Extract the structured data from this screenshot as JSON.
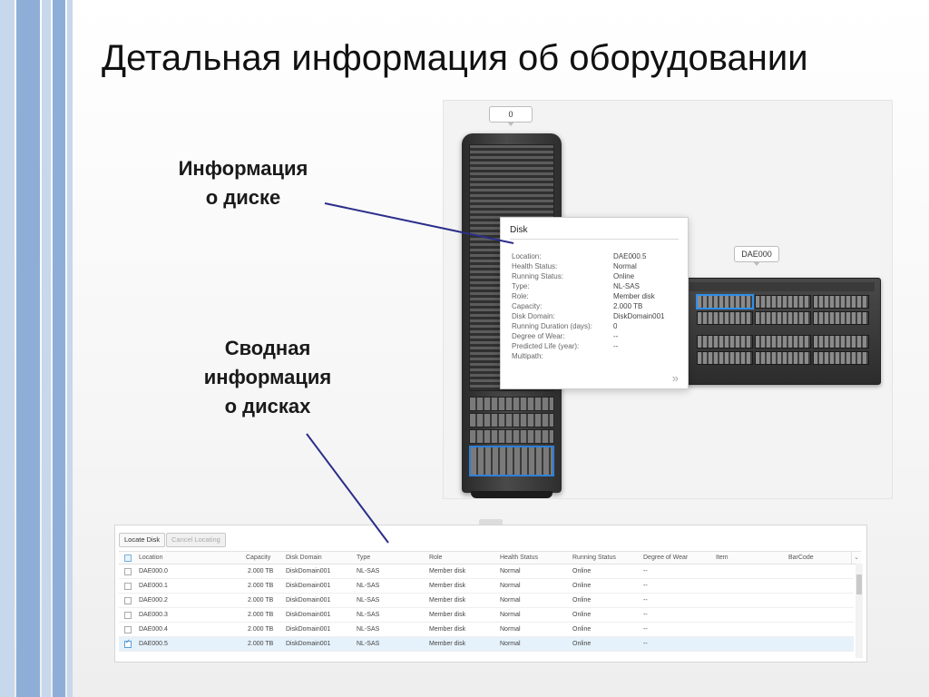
{
  "slide": {
    "title": "Детальная информация об оборудовании",
    "callout_disk": "Информация\nо диске",
    "callout_summary": "Сводная\nинформация\nо дисках",
    "accent_colors": {
      "stripe_dark": "#8eaed8",
      "stripe_light": "#c7d7ec",
      "connector_line": "#2b2e8a"
    }
  },
  "device": {
    "rack_tag": "0",
    "enclosure_tag": "DAE000",
    "popup": {
      "title": "Disk",
      "more_icon": "»",
      "fields": [
        {
          "key": "Location:",
          "value": "DAE000.5"
        },
        {
          "key": "Health Status:",
          "value": "Normal"
        },
        {
          "key": "Running Status:",
          "value": "Online"
        },
        {
          "key": "Type:",
          "value": "NL-SAS"
        },
        {
          "key": "Role:",
          "value": "Member disk"
        },
        {
          "key": "Capacity:",
          "value": "2.000 TB"
        },
        {
          "key": "Disk Domain:",
          "value": "DiskDomain001"
        },
        {
          "key": "Running Duration (days):",
          "value": "0"
        },
        {
          "key": "Degree of Wear:",
          "value": "--"
        },
        {
          "key": "Predicted Life (year):",
          "value": "--"
        },
        {
          "key": "Multipath:",
          "value": ""
        }
      ]
    }
  },
  "grid": {
    "toolbar": {
      "locate": "Locate Disk",
      "cancel": "Cancel Locating"
    },
    "columns": [
      "Location",
      "Capacity",
      "Disk Domain",
      "Type",
      "Role",
      "Health Status",
      "Running Status",
      "Degree of Wear",
      "Item",
      "BarCode"
    ],
    "column_menu_icon": "⌄",
    "rows": [
      {
        "selected": false,
        "cells": [
          "DAE000.0",
          "2.000 TB",
          "DiskDomain001",
          "NL-SAS",
          "Member disk",
          "Normal",
          "Online",
          "--",
          "",
          ""
        ]
      },
      {
        "selected": false,
        "cells": [
          "DAE000.1",
          "2.000 TB",
          "DiskDomain001",
          "NL-SAS",
          "Member disk",
          "Normal",
          "Online",
          "--",
          "",
          ""
        ]
      },
      {
        "selected": false,
        "cells": [
          "DAE000.2",
          "2.000 TB",
          "DiskDomain001",
          "NL-SAS",
          "Member disk",
          "Normal",
          "Online",
          "--",
          "",
          ""
        ]
      },
      {
        "selected": false,
        "cells": [
          "DAE000.3",
          "2.000 TB",
          "DiskDomain001",
          "NL-SAS",
          "Member disk",
          "Normal",
          "Online",
          "--",
          "",
          ""
        ]
      },
      {
        "selected": false,
        "cells": [
          "DAE000.4",
          "2.000 TB",
          "DiskDomain001",
          "NL-SAS",
          "Member disk",
          "Normal",
          "Online",
          "--",
          "",
          ""
        ]
      },
      {
        "selected": true,
        "cells": [
          "DAE000.5",
          "2.000 TB",
          "DiskDomain001",
          "NL-SAS",
          "Member disk",
          "Normal",
          "Online",
          "--",
          "",
          ""
        ]
      }
    ]
  }
}
